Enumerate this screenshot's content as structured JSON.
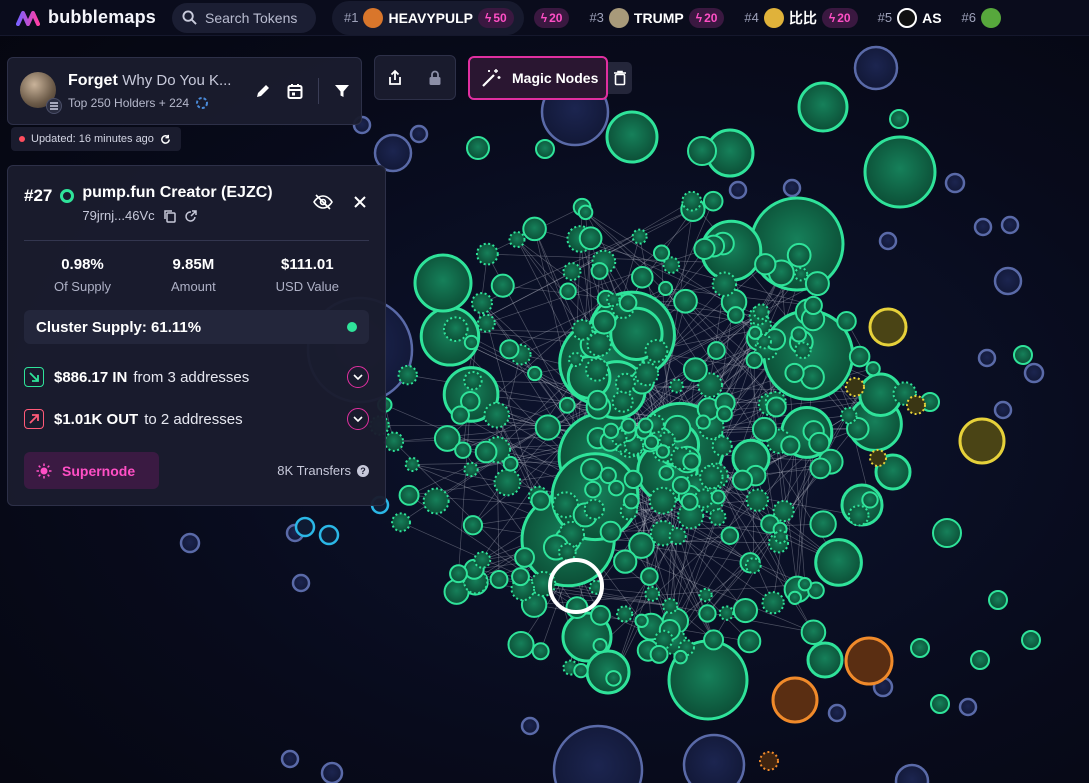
{
  "app": {
    "name": "bubblemaps"
  },
  "search": {
    "placeholder": "Search Tokens"
  },
  "ticker": [
    {
      "rank": "#1",
      "name": "HEAVYPULP",
      "boost": "50",
      "color": "#d9762b"
    },
    {
      "rank": "",
      "name": "",
      "boost": "20",
      "color": ""
    },
    {
      "rank": "#3",
      "name": "TRUMP",
      "boost": "20",
      "color": "#a89a7a"
    },
    {
      "rank": "#4",
      "name": "比比",
      "boost": "20",
      "color": "#e0b23a"
    },
    {
      "rank": "#5",
      "name": "AS",
      "boost": "",
      "color": "#ffffff"
    },
    {
      "rank": "#6",
      "name": "",
      "boost": "",
      "color": "#57a83c"
    }
  ],
  "map": {
    "token_name": "Forget",
    "token_title": "Why Do You K...",
    "holders": "Top 250 Holders + 224",
    "updated": "Updated: 16 minutes ago"
  },
  "tools": {
    "magic_label": "Magic Nodes"
  },
  "node": {
    "rank": "#27",
    "name": "pump.fun Creator (EJZC)",
    "address": "79jrnj...46Vc",
    "stats": [
      {
        "value": "0.98%",
        "label": "Of Supply"
      },
      {
        "value": "9.85M",
        "label": "Amount"
      },
      {
        "value": "$111.01",
        "label": "USD Value"
      }
    ],
    "cluster_supply": "Cluster Supply: 61.11%",
    "in": {
      "amount": "$886.17 IN",
      "desc": "from 3 addresses"
    },
    "out": {
      "amount": "$1.01K OUT",
      "desc": "to 2 addresses"
    },
    "supernode_label": "Supernode",
    "transfers": "8K Transfers"
  },
  "colors": {
    "accent": "#e02fa0",
    "node_green": "#2fe39a",
    "node_fill": "#0f5a3c",
    "node_yellow": "#e6d13a",
    "node_orange": "#f08a2a",
    "node_blue": "#5a6aa8",
    "node_cyan": "#2bb7e6"
  }
}
